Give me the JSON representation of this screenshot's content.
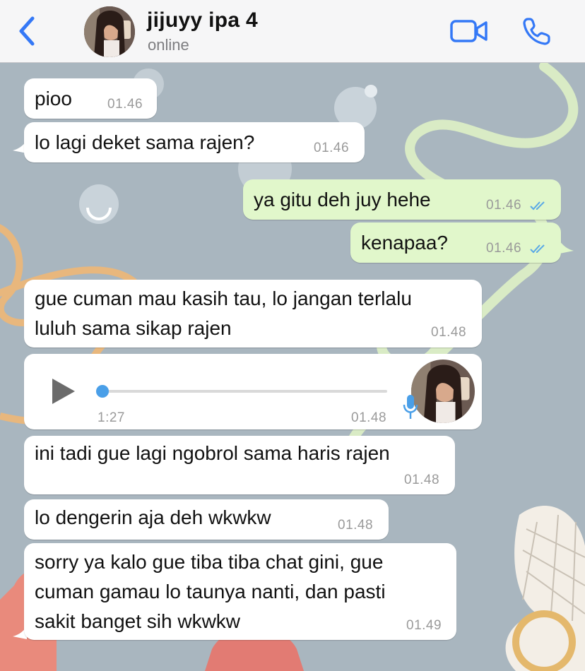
{
  "header": {
    "contact_name": "jijuyy ipa 4",
    "status": "online",
    "icons": [
      "back-chevron-icon",
      "video-call-icon",
      "phone-call-icon"
    ],
    "accent_color": "#3478f6"
  },
  "messages": [
    {
      "direction": "in",
      "text": "pioo",
      "time": "01.46"
    },
    {
      "direction": "in",
      "text": "lo lagi deket sama rajen?",
      "time": "01.46"
    },
    {
      "direction": "out",
      "text": "ya gitu deh juy hehe",
      "time": "01.46",
      "read": true
    },
    {
      "direction": "out",
      "text": "kenapaa?",
      "time": "01.46",
      "read": true
    },
    {
      "direction": "in",
      "lines": [
        "gue cuman mau kasih tau, lo jangan terlalu",
        "luluh sama sikap rajen"
      ],
      "time": "01.48"
    },
    {
      "direction": "in",
      "type": "voice",
      "duration": "1:27",
      "time": "01.48",
      "progress": 0
    },
    {
      "direction": "in",
      "text": "ini tadi gue lagi ngobrol sama haris rajen",
      "time": "01.48"
    },
    {
      "direction": "in",
      "text": "lo dengerin aja deh wkwkw",
      "time": "01.48"
    },
    {
      "direction": "in",
      "lines": [
        "sorry ya kalo gue tiba tiba chat gini, gue",
        "cuman gamau lo taunya nanti, dan pasti",
        "sakit banget sih wkwkw"
      ],
      "time": "01.49"
    }
  ],
  "colors": {
    "incoming_bubble": "#ffffff",
    "outgoing_bubble": "#e1f7cb",
    "read_ticks": "#5aa9e6",
    "chat_background": "#a9b6bf"
  }
}
